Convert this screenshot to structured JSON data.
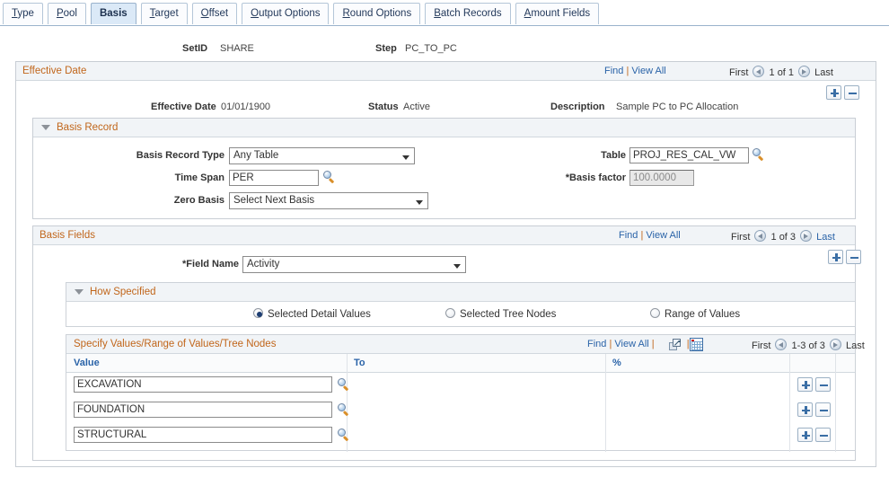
{
  "tabs": [
    {
      "label": "Type",
      "mnemonic": "T",
      "active": false
    },
    {
      "label": "Pool",
      "mnemonic": "P",
      "active": false
    },
    {
      "label": "Basis",
      "mnemonic": "B",
      "active": true
    },
    {
      "label": "Target",
      "mnemonic": "T",
      "active": false
    },
    {
      "label": "Offset",
      "mnemonic": "O",
      "active": false
    },
    {
      "label": "Output Options",
      "mnemonic": "O",
      "active": false
    },
    {
      "label": "Round Options",
      "mnemonic": "R",
      "active": false
    },
    {
      "label": "Batch Records",
      "mnemonic": "B",
      "active": false
    },
    {
      "label": "Amount Fields",
      "mnemonic": "A",
      "active": false
    }
  ],
  "keys": {
    "setid_label": "SetID",
    "setid_value": "SHARE",
    "step_label": "Step",
    "step_value": "PC_TO_PC"
  },
  "effective_date": {
    "title": "Effective Date",
    "find": "Find",
    "pipe": "|",
    "view_all": "View All",
    "first": "First",
    "counter": "1 of 1",
    "last": "Last",
    "date_label": "Effective Date",
    "date_value": "01/01/1900",
    "status_label": "Status",
    "status_value": "Active",
    "description_label": "Description",
    "description_value": "Sample PC to PC Allocation"
  },
  "basis_record": {
    "title": "Basis Record",
    "record_type_label": "Basis Record Type",
    "record_type_value": "Any Table",
    "time_span_label": "Time Span",
    "time_span_value": "PER",
    "zero_basis_label": "Zero Basis",
    "zero_basis_value": "Select Next Basis",
    "table_label": "Table",
    "table_value": "PROJ_RES_CAL_VW",
    "basis_factor_label": "*Basis factor",
    "basis_factor_value": "100.0000"
  },
  "basis_fields": {
    "title": "Basis Fields",
    "find": "Find",
    "pipe": "|",
    "view_all": "View All",
    "first": "First",
    "counter": "1 of 3",
    "last": "Last",
    "field_name_label": "*Field Name",
    "field_name_value": "Activity"
  },
  "how_specified": {
    "title": "How Specified",
    "options": [
      {
        "label": "Selected Detail Values",
        "selected": true
      },
      {
        "label": "Selected Tree Nodes",
        "selected": false
      },
      {
        "label": "Range of Values",
        "selected": false
      }
    ]
  },
  "specify_values": {
    "title": "Specify Values/Range of Values/Tree Nodes",
    "find": "Find",
    "pipe": "|",
    "view_all": "View All",
    "pipe2": "|",
    "pipe3": "|",
    "first": "First",
    "counter": "1-3 of 3",
    "last": "Last",
    "columns": [
      "Value",
      "To",
      "%"
    ],
    "rows": [
      {
        "value": "EXCAVATION",
        "to": "",
        "pct": ""
      },
      {
        "value": "FOUNDATION",
        "to": "",
        "pct": ""
      },
      {
        "value": "STRUCTURAL",
        "to": "",
        "pct": ""
      }
    ]
  },
  "icons": {
    "lookup": "magnifier-lookup-icon",
    "popup": "new-window-icon",
    "grid": "spreadsheet-grid-icon",
    "prev": "prev-arrow-icon",
    "next": "next-arrow-icon",
    "collapse": "collapse-triangle-icon",
    "add_row": "add-row-icon",
    "delete_row": "delete-row-icon"
  },
  "colors": {
    "header_text": "#c1661b",
    "link": "#2a63a8",
    "column_header": "#2a63a8",
    "header_bg": "#f1f4f7",
    "active_tab_bg": "#dbe9f7"
  }
}
